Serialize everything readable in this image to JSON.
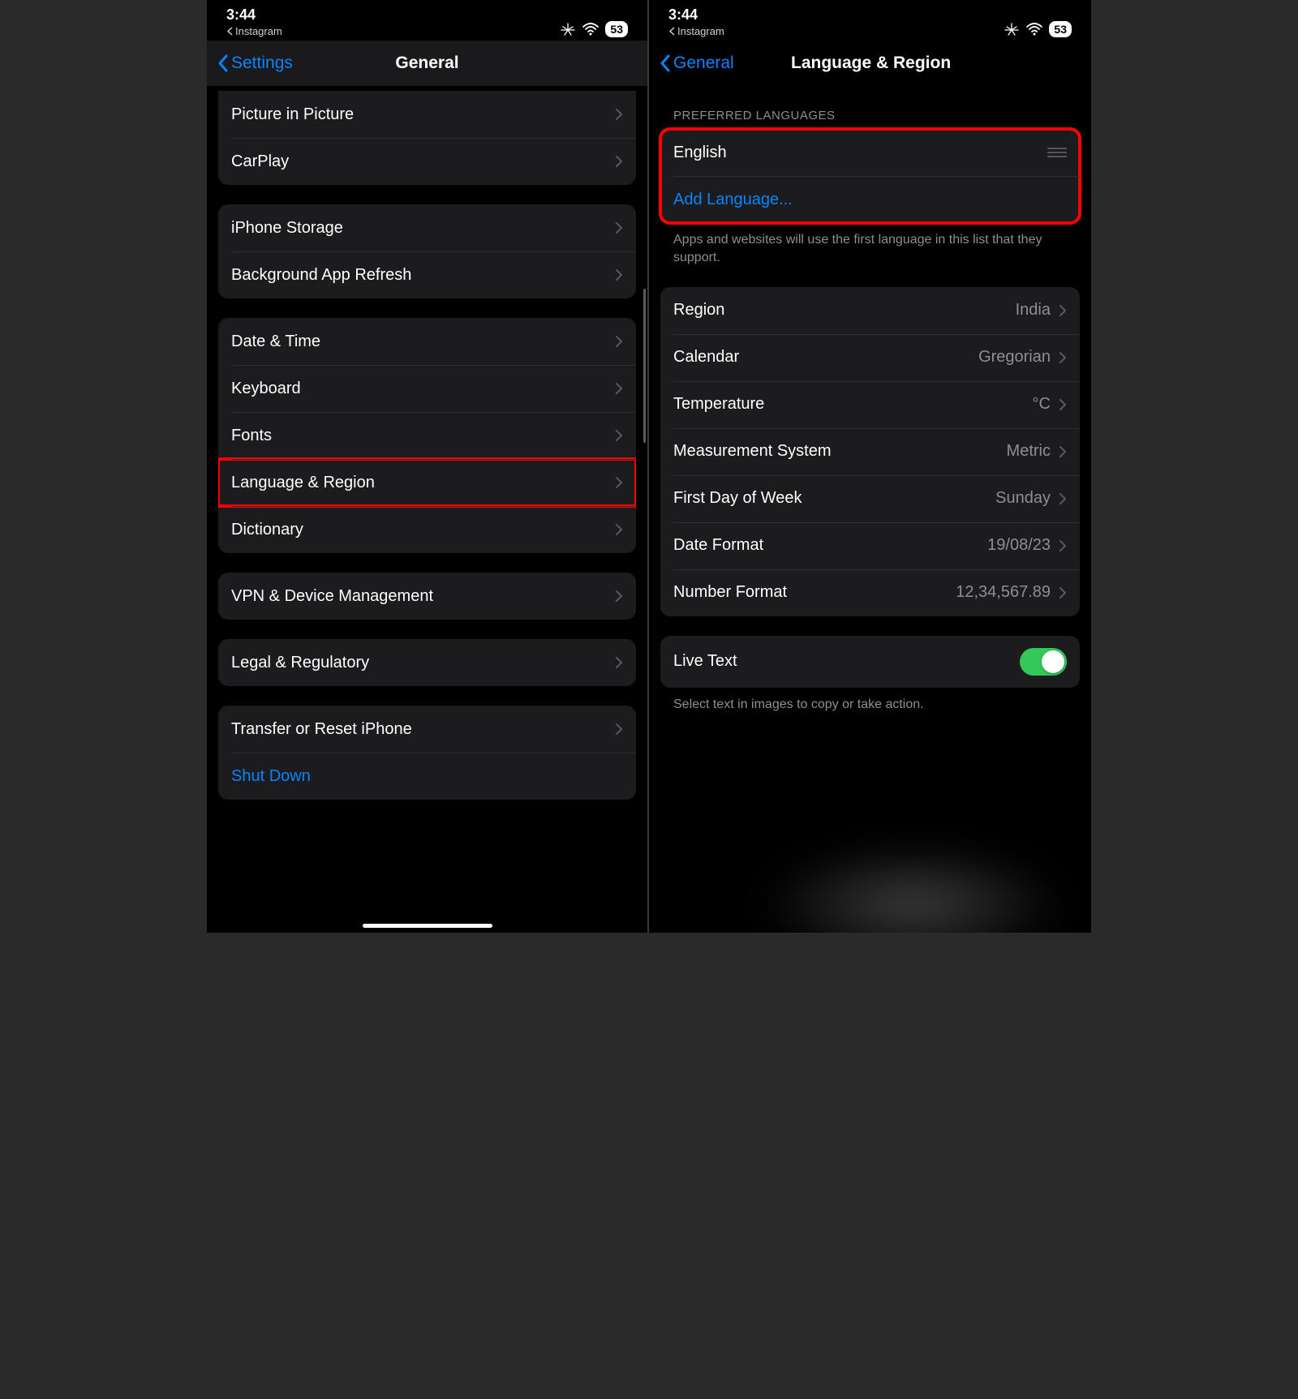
{
  "status": {
    "time": "3:44",
    "back_app_label": "Instagram",
    "battery": "53"
  },
  "left": {
    "back_label": "Settings",
    "title": "General",
    "groups": [
      {
        "rows": [
          {
            "label": "Picture in Picture"
          },
          {
            "label": "CarPlay"
          }
        ]
      },
      {
        "rows": [
          {
            "label": "iPhone Storage"
          },
          {
            "label": "Background App Refresh"
          }
        ]
      },
      {
        "rows": [
          {
            "label": "Date & Time"
          },
          {
            "label": "Keyboard"
          },
          {
            "label": "Fonts"
          },
          {
            "label": "Language & Region",
            "highlight": true
          },
          {
            "label": "Dictionary"
          }
        ]
      },
      {
        "rows": [
          {
            "label": "VPN & Device Management"
          }
        ]
      },
      {
        "rows": [
          {
            "label": "Legal & Regulatory"
          }
        ]
      },
      {
        "rows": [
          {
            "label": "Transfer or Reset iPhone"
          },
          {
            "label": "Shut Down",
            "link": true,
            "no_chev": true
          }
        ]
      }
    ]
  },
  "right": {
    "back_label": "General",
    "title": "Language & Region",
    "preferred_header": "PREFERRED LANGUAGES",
    "preferred_lang": "English",
    "add_language": "Add Language...",
    "preferred_footer": "Apps and websites will use the first language in this list that they support.",
    "region_rows": [
      {
        "label": "Region",
        "value": "India"
      },
      {
        "label": "Calendar",
        "value": "Gregorian"
      },
      {
        "label": "Temperature",
        "value": "°C"
      },
      {
        "label": "Measurement System",
        "value": "Metric"
      },
      {
        "label": "First Day of Week",
        "value": "Sunday"
      },
      {
        "label": "Date Format",
        "value": "19/08/23"
      },
      {
        "label": "Number Format",
        "value": "12,34,567.89"
      }
    ],
    "live_text_label": "Live Text",
    "live_text_footer": "Select text in images to copy or take action."
  }
}
